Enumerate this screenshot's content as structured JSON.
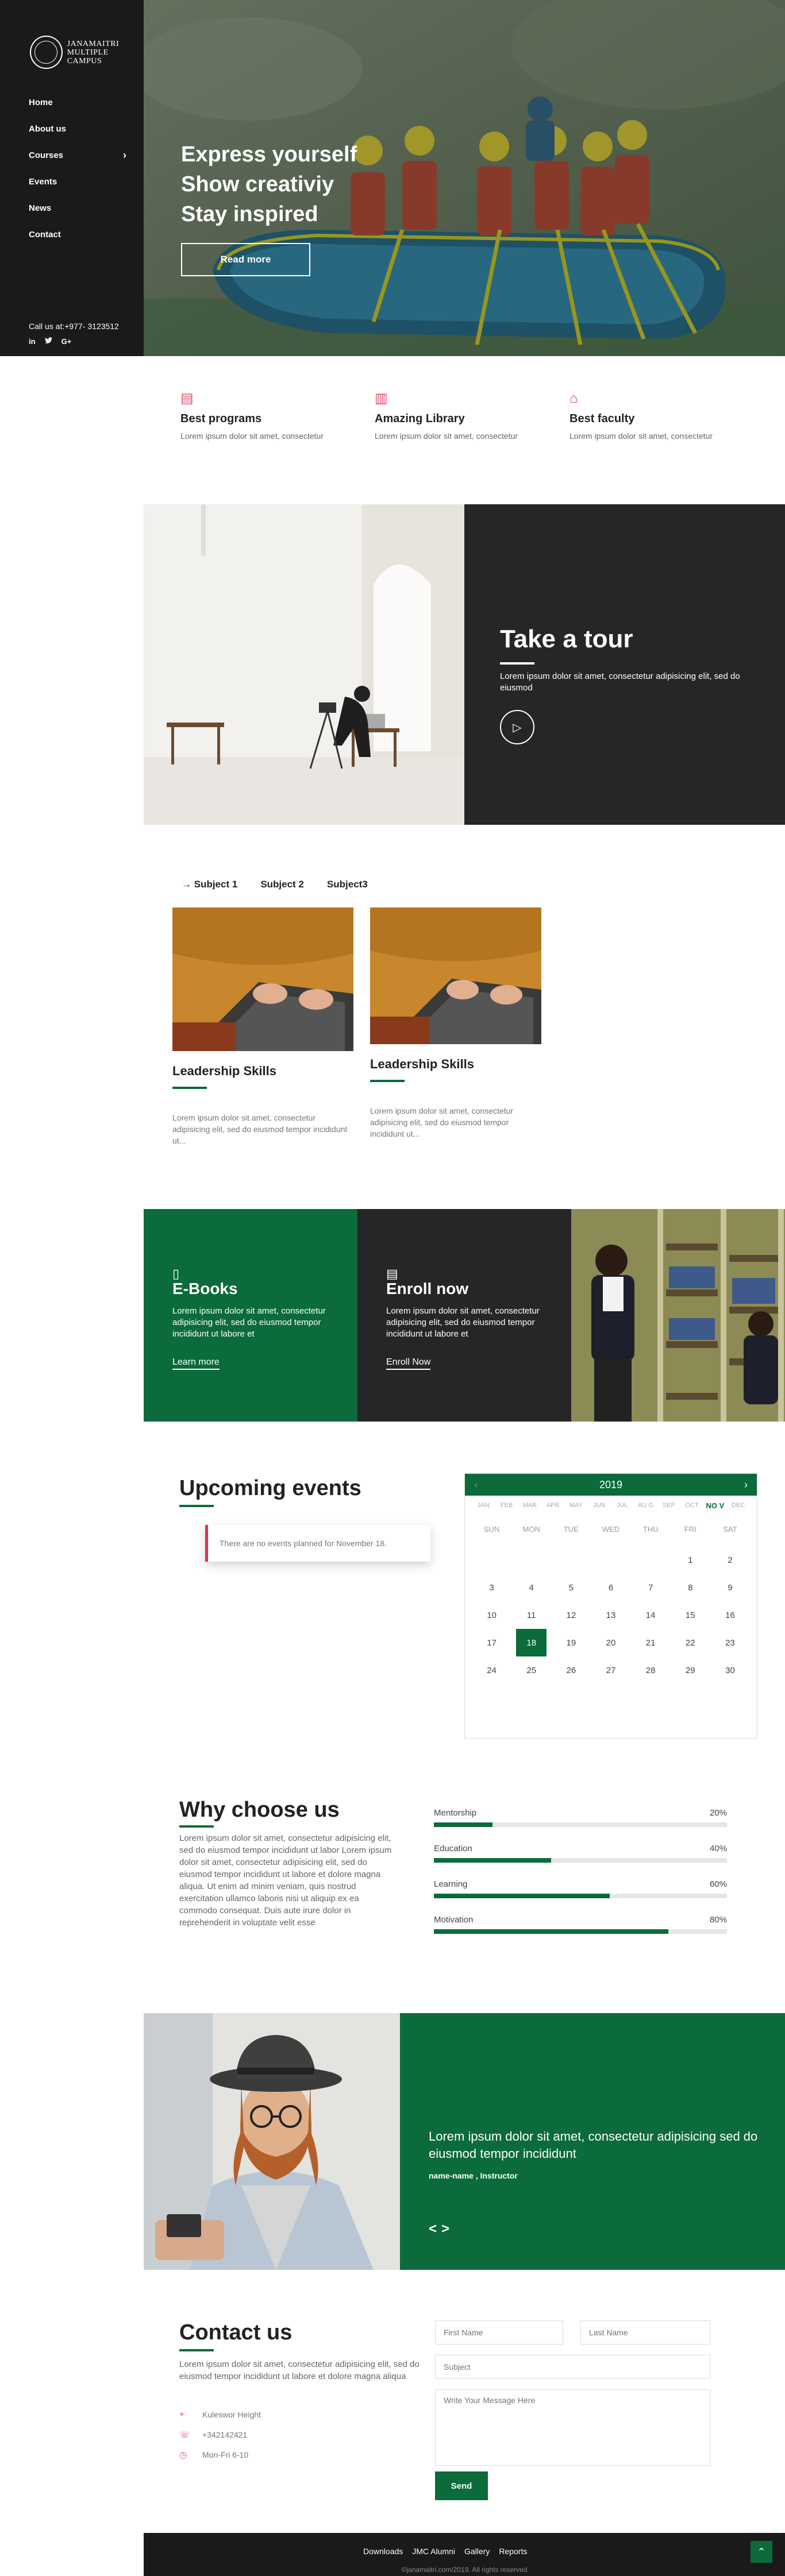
{
  "brand": {
    "line1": "JANAMAITRI",
    "line2": "MULTIPLE CAMPUS"
  },
  "nav": [
    {
      "label": "Home"
    },
    {
      "label": "About us"
    },
    {
      "label": "Courses",
      "has_children": true
    },
    {
      "label": "Events"
    },
    {
      "label": "News"
    },
    {
      "label": "Contact"
    }
  ],
  "sidebar": {
    "call": "Call us at:+977- 3123512",
    "social": [
      "in",
      "twitter-icon",
      "G+"
    ]
  },
  "hero": {
    "line1": "Express yourself",
    "line2": "Show creativiy",
    "line3": "Stay inspired",
    "button": "Read more"
  },
  "features": [
    {
      "icon": "book-icon",
      "title": "Best programs",
      "text": "Lorem ipsum dolor sit amet, consectetur"
    },
    {
      "icon": "library-icon",
      "title": "Amazing Library",
      "text": "Lorem ipsum dolor sit amet, consectetur"
    },
    {
      "icon": "faculty-icon",
      "title": "Best faculty",
      "text": "Lorem ipsum dolor sit amet, consectetur"
    }
  ],
  "tour": {
    "title": "Take a tour",
    "text": "Lorem ipsum dolor sit amet, consectetur adipisicing elit, sed do eiusmod"
  },
  "subjects": {
    "tabs": [
      "→ Subject 1",
      "Subject 2",
      "Subject3"
    ],
    "cards": [
      {
        "title": "Leadership Skills",
        "text": "Lorem ipsum dolor sit amet, consectetur adipisicing elit, sed do eiusmod tempor incididunt ut..."
      },
      {
        "title": "Leadership Skills",
        "text": "Lorem ipsum dolor sit amet, consectetur adipisicing elit, sed do eiusmod tempor incididunt ut..."
      }
    ]
  },
  "promos": [
    {
      "title": "E-Books",
      "text": "Lorem ipsum dolor sit amet, consectetur adipisicing elit, sed do eiusmod tempor incididunt ut labore et",
      "link": "Learn more"
    },
    {
      "title": "Enroll now",
      "text": "Lorem ipsum dolor sit amet, consectetur adipisicing elit, sed do eiusmod tempor incididunt ut labore et",
      "link": "Enroll Now"
    }
  ],
  "events": {
    "title": "Upcoming events",
    "empty": "There are no events planned for November 18."
  },
  "calendar": {
    "year": "2019",
    "months": [
      "JAN",
      "FEB",
      "MAR",
      "APR",
      "MAY",
      "JUN",
      "JUL",
      "AU G",
      "SEP",
      "OCT",
      "NO V",
      "DEC"
    ],
    "active_month_index": 10,
    "days": [
      "SUN",
      "MON",
      "TUE",
      "WED",
      "THU",
      "FRI",
      "SAT"
    ],
    "leading_blanks": 5,
    "dates": [
      1,
      2,
      3,
      4,
      5,
      6,
      7,
      8,
      9,
      10,
      11,
      12,
      13,
      14,
      15,
      16,
      17,
      18,
      19,
      20,
      21,
      22,
      23,
      24,
      25,
      26,
      27,
      28,
      29,
      30
    ],
    "selected": 18
  },
  "why": {
    "title": "Why choose us",
    "text": "Lorem ipsum dolor sit amet, consectetur adipisicing elit, sed do eiusmod tempor incididunt ut labor Lorem ipsum dolor sit amet, consectetur adipisicing elit, sed do eiusmod tempor incididunt ut labore et dolore magna aliqua. Ut enim ad minim veniam, quis nostrud exercitation ullamco laboris nisi ut aliquip ex ea commodo consequat. Duis aute irure dolor in reprehenderit in voluptate velit esse",
    "skills": [
      {
        "name": "Mentorship",
        "value": 20,
        "label": "20%"
      },
      {
        "name": "Education",
        "value": 40,
        "label": "40%"
      },
      {
        "name": "Learning",
        "value": 60,
        "label": "60%"
      },
      {
        "name": "Motivation",
        "value": 80,
        "label": "80%"
      }
    ]
  },
  "testimonial": {
    "quote": "Lorem ipsum dolor sit amet, consectetur adipisicing sed do eiusmod tempor incididunt",
    "author": "name-name , Instructor",
    "prev": "<",
    "next": ">"
  },
  "contact": {
    "title": "Contact us",
    "text": "Lorem ipsum dolor sit amet, consectetur adipisicing elit, sed do eiusmod tempor incididunt ut labore et dolore magna aliqua",
    "address": "Kuleswor Height",
    "phone": "+342142421",
    "hours": "Mon-Fri 6-10",
    "first_name": "First Name",
    "last_name": "Last Name",
    "subject": "Subject",
    "message": "Write Your Message Here",
    "send": "Send"
  },
  "footer": {
    "links": [
      "Downloads",
      "JMC Alumni",
      "Gallery",
      "Reports"
    ],
    "copy": "©janamaitri.com/2019. All rights reserved"
  },
  "colors": {
    "accent": "#0b6b3a",
    "dark": "#1a1a1a",
    "panel": "#262626",
    "pink": "#e04a6a"
  }
}
